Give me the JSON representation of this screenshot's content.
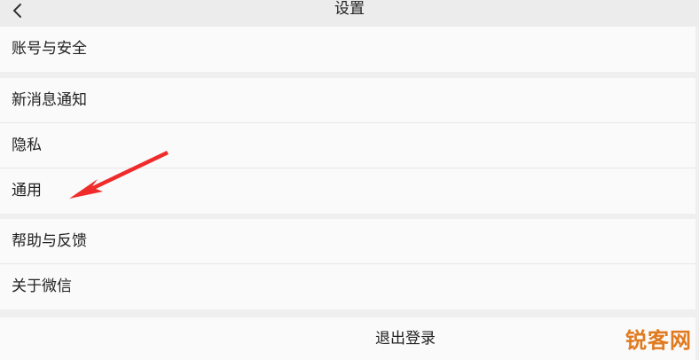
{
  "header": {
    "title": "设置",
    "back_icon": "chevron-left-icon"
  },
  "groups": [
    {
      "items": [
        {
          "label": "账号与安全"
        }
      ]
    },
    {
      "items": [
        {
          "label": "新消息通知"
        },
        {
          "label": "隐私"
        },
        {
          "label": "通用"
        }
      ]
    },
    {
      "items": [
        {
          "label": "帮助与反馈"
        },
        {
          "label": "关于微信"
        }
      ]
    }
  ],
  "logout": {
    "label": "退出登录"
  },
  "annotation": {
    "arrow_color": "#ef2b2b"
  },
  "watermark": {
    "text": "锐客网",
    "color": "#e07a1f"
  }
}
